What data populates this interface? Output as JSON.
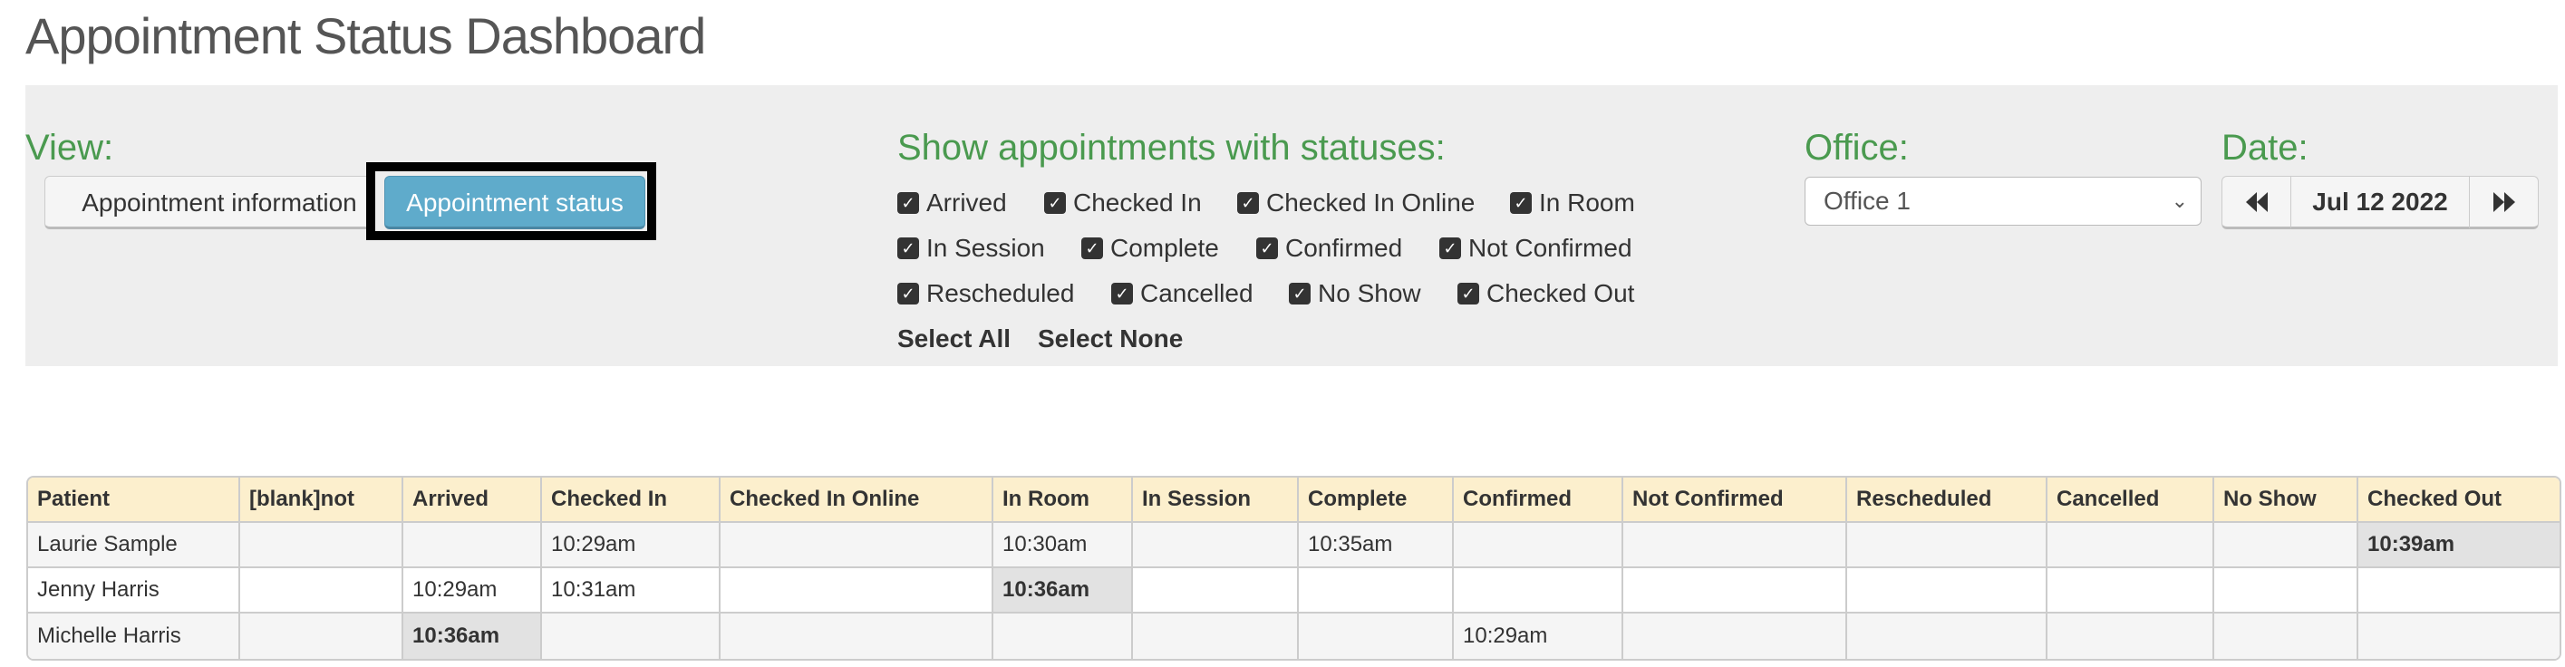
{
  "page": {
    "title": "Appointment Status Dashboard"
  },
  "view": {
    "label": "View:",
    "buttons": [
      {
        "label": "Appointment information",
        "active": false
      },
      {
        "label": "Appointment status",
        "active": true
      }
    ]
  },
  "statuses": {
    "label": "Show appointments with statuses:",
    "rows": [
      [
        {
          "label": "Arrived",
          "checked": true
        },
        {
          "label": "Checked In",
          "checked": true
        },
        {
          "label": "Checked In Online",
          "checked": true
        },
        {
          "label": "In Room",
          "checked": true
        }
      ],
      [
        {
          "label": "In Session",
          "checked": true
        },
        {
          "label": "Complete",
          "checked": true
        },
        {
          "label": "Confirmed",
          "checked": true
        },
        {
          "label": "Not Confirmed",
          "checked": true
        }
      ],
      [
        {
          "label": "Rescheduled",
          "checked": true
        },
        {
          "label": "Cancelled",
          "checked": true
        },
        {
          "label": "No Show",
          "checked": true
        },
        {
          "label": "Checked Out",
          "checked": true
        }
      ]
    ],
    "select_all": "Select All",
    "select_none": "Select None"
  },
  "office": {
    "label": "Office:",
    "selected": "Office 1"
  },
  "date": {
    "label": "Date:",
    "value": "Jul 12 2022",
    "prev_icon": "double-left-triangle",
    "next_icon": "double-right-triangle"
  },
  "table": {
    "columns": [
      "Patient",
      "[blank]not",
      "Arrived",
      "Checked In",
      "Checked In Online",
      "In Room",
      "In Session",
      "Complete",
      "Confirmed",
      "Not Confirmed",
      "Rescheduled",
      "Cancelled",
      "No Show",
      "Checked Out"
    ],
    "rows": [
      {
        "cells": [
          "Laurie Sample",
          "",
          "",
          "10:29am",
          "",
          "10:30am",
          "",
          "10:35am",
          "",
          "",
          "",
          "",
          "",
          "10:39am"
        ],
        "current_col": 13
      },
      {
        "cells": [
          "Jenny Harris",
          "",
          "10:29am",
          "10:31am",
          "",
          "10:36am",
          "",
          "",
          "",
          "",
          "",
          "",
          "",
          ""
        ],
        "current_col": 5
      },
      {
        "cells": [
          "Michelle Harris",
          "",
          "10:36am",
          "",
          "",
          "",
          "",
          "",
          "10:29am",
          "",
          "",
          "",
          "",
          ""
        ],
        "current_col": 2
      }
    ]
  },
  "colors": {
    "label_green": "#4a9a4f",
    "header_bg": "#fcefcd",
    "primary_button": "#5fabcb",
    "current_cell": "#e2e2e2",
    "panel_bg": "#eeeeee"
  }
}
